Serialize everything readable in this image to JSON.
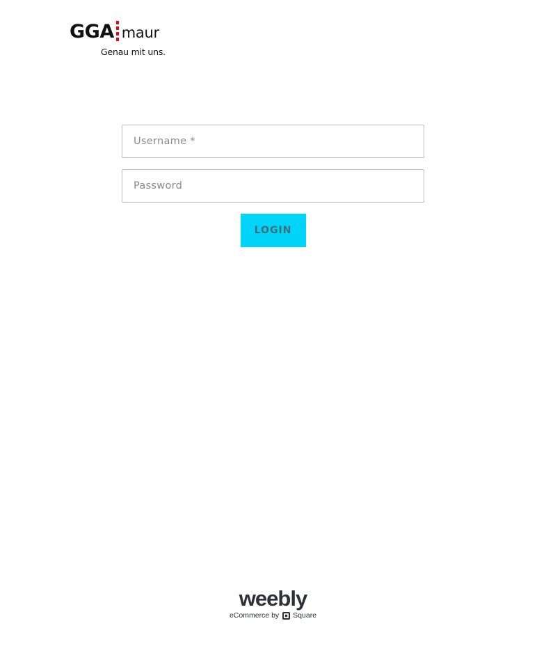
{
  "logo": {
    "wordmark_left": "GGA",
    "wordmark_right": "maur",
    "tagline": "Genau mit uns.",
    "accent_color": "#e30613"
  },
  "login_form": {
    "username_placeholder": "Username *",
    "username_value": "",
    "password_placeholder": "Password",
    "password_value": "",
    "submit_label": "LOGIN",
    "submit_color": "#00d4f8"
  },
  "footer": {
    "brand": "weebly",
    "ecommerce_by": "eCommerce by",
    "square_label": "Square",
    "icon": "square-logo-icon"
  }
}
